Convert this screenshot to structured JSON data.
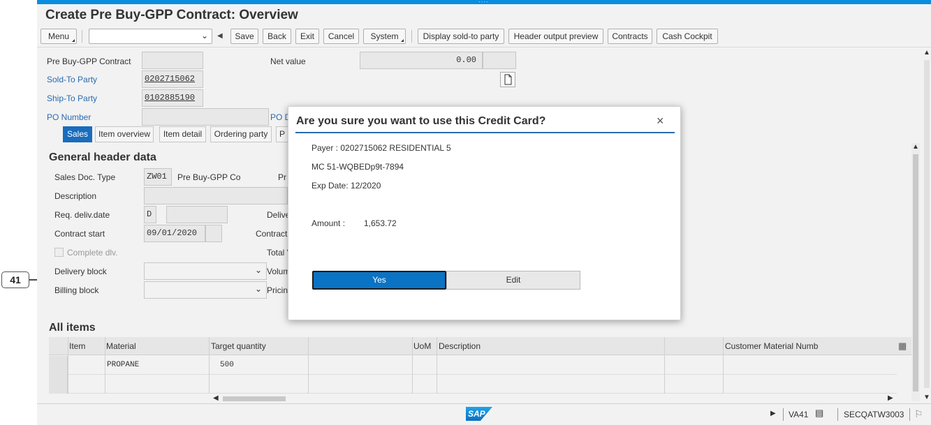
{
  "window": {
    "title": "Create Pre Buy-GPP Contract: Overview",
    "grip": "····"
  },
  "toolbar": {
    "menu": "Menu",
    "combo_value": "",
    "save": "Save",
    "back": "Back",
    "exit": "Exit",
    "cancel": "Cancel",
    "system": "System",
    "display_sold_to": "Display sold-to party",
    "header_output_preview": "Header output preview",
    "contracts": "Contracts",
    "cash_cockpit": "Cash Cockpit"
  },
  "header": {
    "contract_label": "Pre Buy-GPP Contract",
    "contract_value": "",
    "net_value_label": "Net value",
    "net_value": "0.00",
    "currency": "",
    "sold_to_label": "Sold-To Party",
    "sold_to_value": "0202715062",
    "ship_to_label": "Ship-To Party",
    "ship_to_value": "0102885190",
    "po_number_label": "PO Number",
    "po_number_value": "",
    "po_date_label": "PO D"
  },
  "tabs": [
    "Sales",
    "Item overview",
    "Item detail",
    "Ordering party",
    "P"
  ],
  "general": {
    "section_title": "General header data",
    "doc_type_label": "Sales Doc. Type",
    "doc_type_value": "ZW01",
    "doc_type_text": "Pre Buy-GPP Co",
    "doc_type_trailing": "Pr",
    "description_label": "Description",
    "description_value": "",
    "req_deliv_label": "Req. deliv.date",
    "req_deliv_unit": "D",
    "req_deliv_value": "",
    "deliv_right_label": "Delive",
    "contract_start_label": "Contract start",
    "contract_start_value": "09/01/2020",
    "contract_right_label": "Contract",
    "complete_dlv_label": "Complete dlv.",
    "total_label": "Total '",
    "delivery_block_label": "Delivery block",
    "volume_label": "Volum",
    "billing_block_label": "Billing block",
    "pricing_label": "Pricin"
  },
  "items": {
    "section_title": "All items",
    "columns": [
      "Item",
      "Material",
      "Target quantity",
      "UoM",
      "Description",
      "Customer Material Numb"
    ],
    "rows": [
      {
        "item": "",
        "material": "PROPANE",
        "target_quantity": "500",
        "uom": "",
        "description": ""
      },
      {
        "item": "",
        "material": "",
        "target_quantity": "",
        "uom": "",
        "description": ""
      }
    ]
  },
  "status": {
    "logo": "SAP",
    "transaction": "VA41",
    "system": "SECQATW3003"
  },
  "dialog": {
    "title": "Are you sure you want to use this Credit Card?",
    "close": "×",
    "payer": "Payer : 0202715062 RESIDENTIAL 5",
    "card": "MC 51-WQBEDp9t-7894",
    "exp": "Exp Date: 12/2020",
    "amount_label": "Amount :",
    "amount_value": "1,653.72",
    "yes": "Yes",
    "edit": "Edit"
  },
  "annotation": {
    "callout": "41"
  },
  "colors": {
    "accent": "#0a73c4",
    "link": "#2a6bb0",
    "topbar": "#0a8ddf"
  }
}
